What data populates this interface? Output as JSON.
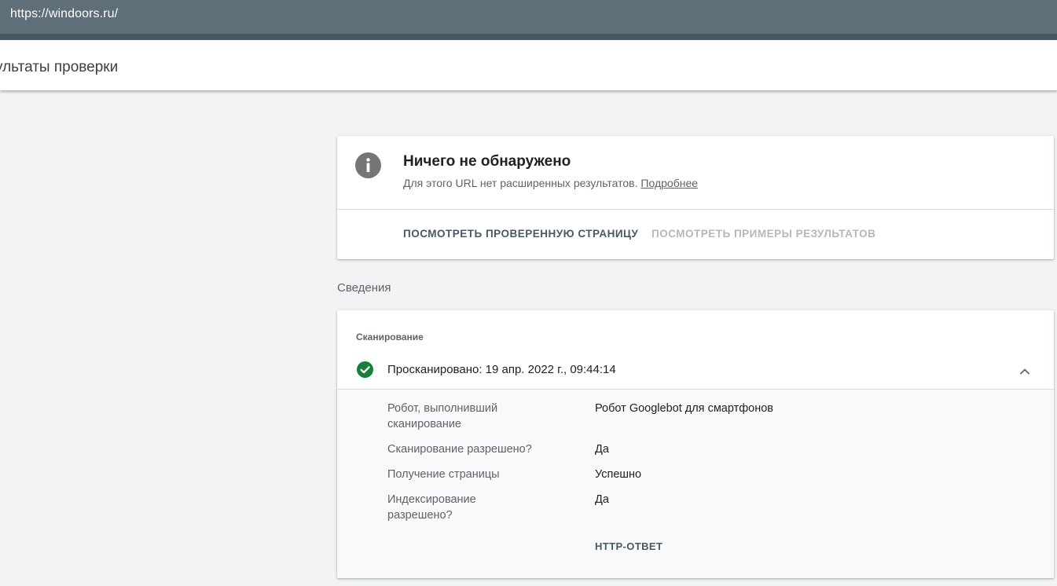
{
  "browser": {
    "url": "https://windoors.ru/"
  },
  "header": {
    "title": "ультаты проверки"
  },
  "summary": {
    "icon": "info-icon",
    "title": "Ничего не обнаружено",
    "subtitle": "Для этого URL нет расширенных результатов.",
    "learn_more": "Подробнее",
    "actions": {
      "view_page": "ПОСМОТРЕТЬ ПРОВЕРЕННУЮ СТРАНИЦУ",
      "view_examples": "ПОСМОТРЕТЬ ПРИМЕРЫ РЕЗУЛЬТАТОВ"
    }
  },
  "details": {
    "section_label": "Сведения",
    "group_label": "Сканирование",
    "crawled": "Просканировано: 19 апр. 2022 г., 09:44:14",
    "rows": [
      {
        "label": "Робот, выполнивший сканирование",
        "value": "Робот Googlebot для смартфонов"
      },
      {
        "label": "Сканирование разрешено?",
        "value": "Да"
      },
      {
        "label": "Получение страницы",
        "value": "Успешно"
      },
      {
        "label": "Индексирование разрешено?",
        "value": "Да"
      }
    ],
    "http_response": "HTTP-ОТВЕТ"
  },
  "colors": {
    "topbar": "#5f6f7a",
    "success": "#188038",
    "info": "#757575",
    "action": "#455a64",
    "action_disabled": "#b4b8bb"
  }
}
